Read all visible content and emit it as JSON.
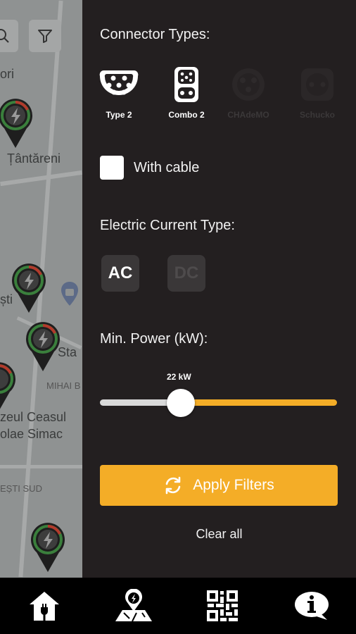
{
  "map": {
    "labels": [
      "ori",
      "Țântăreni",
      "ști",
      "Sta",
      "MIHAI B",
      "zeul Ceasul",
      "olae Simac",
      "EȘTI SUD"
    ]
  },
  "panel": {
    "connector_title": "Connector Types:",
    "connectors": [
      {
        "label": "Type 2",
        "icon": "type2-plug-icon",
        "selected": true
      },
      {
        "label": "Combo 2",
        "icon": "combo2-plug-icon",
        "selected": true
      },
      {
        "label": "CHAdeMO",
        "icon": "chademo-plug-icon",
        "selected": false
      },
      {
        "label": "Schucko",
        "icon": "schuko-plug-icon",
        "selected": false
      }
    ],
    "with_cable_label": "With cable",
    "current_title": "Electric Current Type:",
    "current": {
      "ac": "AC",
      "dc": "DC"
    },
    "power_title": "Min. Power (kW):",
    "power_value_label": "22 kW",
    "power_level_fraction": 0.34,
    "apply_label": "Apply Filters",
    "clear_label": "Clear all"
  },
  "nav": {
    "items": [
      "home-charging-icon",
      "map-location-icon",
      "qr-code-icon",
      "info-icon"
    ]
  },
  "colors": {
    "accent": "#f4ad27",
    "panel": "#231f20",
    "nav": "#000000"
  }
}
